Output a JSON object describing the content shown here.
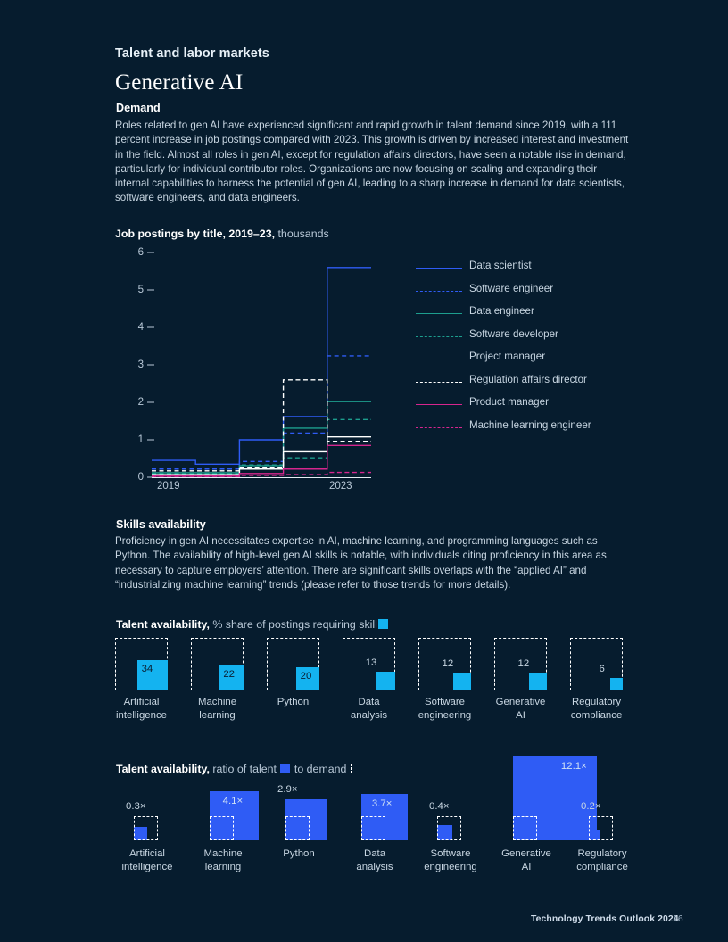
{
  "page": {
    "kicker": "Talent and labor markets",
    "title": "Generative AI",
    "background_color": "#061c2e"
  },
  "demand": {
    "heading": "Demand",
    "body": "Roles related to gen AI have experienced significant and rapid growth in talent demand since 2019, with a 111 percent increase in job postings compared with 2023. This growth is driven by increased interest and investment in the field. Almost all roles in gen AI, except for regulation affairs directors, have seen a notable rise in demand, particularly for individual contributor roles. Organizations are now focusing on scaling and expanding their internal capabilities to harness the potential of gen AI, leading to a sharp increase in demand for data scientists, software engineers, and data engineers."
  },
  "skills": {
    "heading": "Skills availability",
    "body": "Proficiency in gen AI necessitates expertise in AI, machine learning, and programming languages such as Python. The availability of high-level gen AI skills is notable, with individuals citing proficiency in this area as necessary to capture employers’ attention. There are significant skills overlaps with the “applied AI” and “industrializing machine learning” trends (please refer to those trends for more details)."
  },
  "chart_data": [
    {
      "type": "line",
      "title_bold": "Job postings by title, 2019–23,",
      "title_rest": " thousands",
      "xlabel": "",
      "ylabel": "",
      "x": [
        2019,
        2020,
        2021,
        2022,
        2023
      ],
      "xtick_labels": [
        "2019",
        "2023"
      ],
      "ylim": [
        0,
        6
      ],
      "yticks": [
        0,
        1,
        2,
        3,
        4,
        5,
        6
      ],
      "ytick_labels": [
        "0",
        "1",
        "2",
        "3",
        "4",
        "5",
        "6"
      ],
      "grid": false,
      "legend_position": "right",
      "step": "pre",
      "series": [
        {
          "name": "Data scientist",
          "color": "#2f5cf5",
          "dash": "solid",
          "values": [
            0.45,
            0.35,
            1.0,
            1.62,
            5.6
          ]
        },
        {
          "name": "Software engineer",
          "color": "#2f5cf5",
          "dash": "dashed",
          "values": [
            0.22,
            0.22,
            0.42,
            1.18,
            3.24
          ]
        },
        {
          "name": "Data engineer",
          "color": "#1d9e8e",
          "dash": "solid",
          "values": [
            0.12,
            0.12,
            0.31,
            1.31,
            2.02
          ]
        },
        {
          "name": "Software developer",
          "color": "#1d9e8e",
          "dash": "dashed",
          "values": [
            0.1,
            0.1,
            0.33,
            0.52,
            1.54
          ]
        },
        {
          "name": "Project manager",
          "color": "#ffffff",
          "dash": "solid",
          "values": [
            0.07,
            0.07,
            0.22,
            0.68,
            1.08
          ]
        },
        {
          "name": "Regulation affairs director",
          "color": "#ffffff",
          "dash": "dashed",
          "values": [
            0.17,
            0.17,
            0.25,
            2.6,
            0.96
          ]
        },
        {
          "name": "Product manager",
          "color": "#d6268e",
          "dash": "solid",
          "values": [
            0.03,
            0.03,
            0.1,
            0.22,
            0.85
          ]
        },
        {
          "name": "Machine learning engineer",
          "color": "#d6268e",
          "dash": "dashed",
          "values": [
            0.02,
            0.02,
            0.05,
            0.07,
            0.13
          ]
        }
      ]
    },
    {
      "type": "bar",
      "title_bold": "Talent availability,",
      "title_rest": " % share of postings requiring skill",
      "legend_swatch": "solid-cyan",
      "unit": "%",
      "color": "#14b3f0",
      "reference_color": "#ffffff",
      "max": 100,
      "categories": [
        "Artificial\nintelligence",
        "Machine\nlearning",
        "Python",
        "Data\nanalysis",
        "Software\nengineering",
        "Generative\nAI",
        "Regulatory\ncompliance"
      ],
      "values": [
        34,
        22,
        20,
        13,
        12,
        12,
        6
      ],
      "value_labels": [
        "34",
        "22",
        "20",
        "13",
        "12",
        "12",
        "6"
      ]
    },
    {
      "type": "bar",
      "title_bold": "Talent availability,",
      "title_rest_a": " ratio of talent ",
      "title_rest_b": " to demand ",
      "legend_swatch_a": "solid-blue",
      "legend_swatch_b": "dash",
      "unit": "×",
      "color": "#2f5cf5",
      "reference_color": "#ffffff",
      "reference_value": 1,
      "categories": [
        "Artificial\nintelligence",
        "Machine\nlearning",
        "Python",
        "Data\nanalysis",
        "Software\nengineering",
        "Generative\nAI",
        "Regulatory\ncompliance"
      ],
      "values": [
        0.3,
        4.1,
        2.9,
        3.7,
        0.4,
        12.1,
        0.2
      ],
      "value_labels": [
        "0.3×",
        "4.1×",
        "2.9×",
        "3.7×",
        "0.4×",
        "12.1×",
        "0.2×"
      ]
    }
  ],
  "footer": {
    "source": "Technology Trends Outlook 2024",
    "page_number": "16"
  }
}
